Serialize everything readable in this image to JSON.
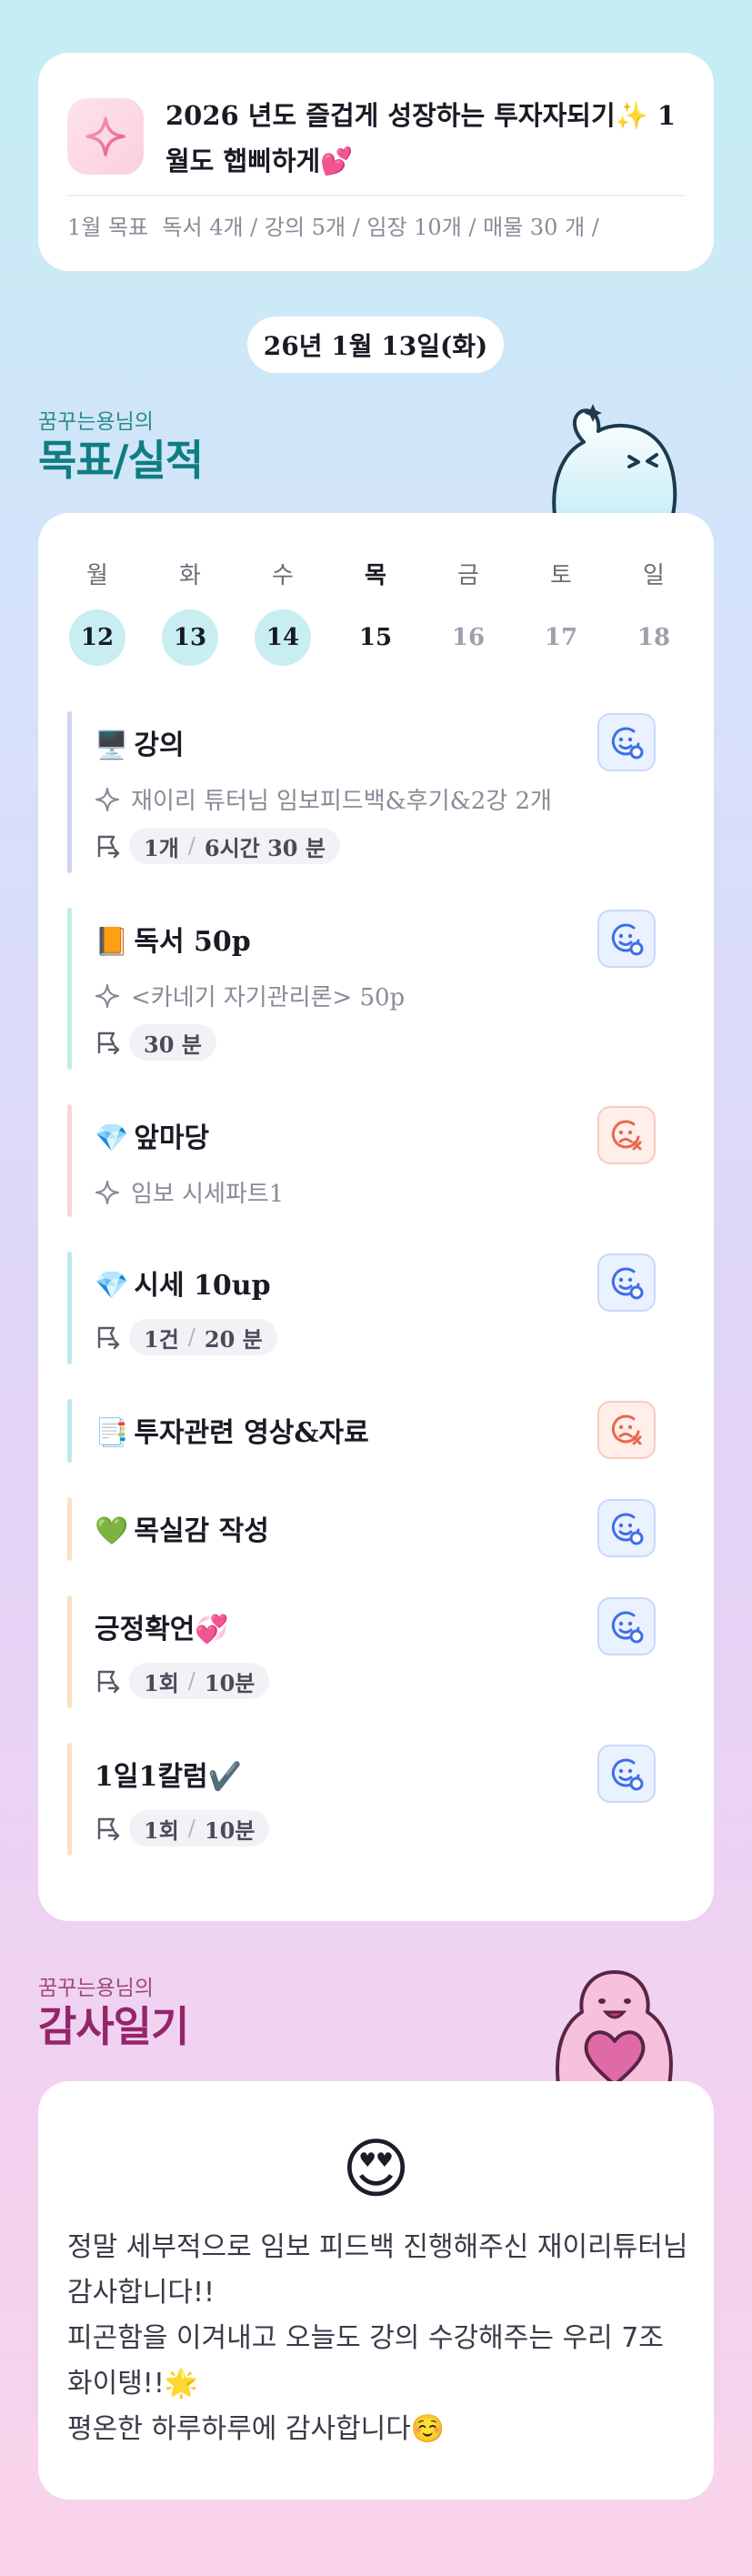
{
  "goal": {
    "title": "2026 년도 즐겁게 성장하는 투자자되기✨ 1월도 햅삐하게💕",
    "monthly_label": "1월 목표",
    "monthly_items": "독서 4개 / 강의 5개 / 임장 10개 / 매물 30 개 /"
  },
  "date_pill": "26년 1월 13일(화)",
  "section_goals": {
    "subtitle": "꿈꾸는용님의",
    "title": "목표/실적"
  },
  "week": {
    "days": [
      {
        "name": "월",
        "date": "12"
      },
      {
        "name": "화",
        "date": "13"
      },
      {
        "name": "수",
        "date": "14"
      },
      {
        "name": "목",
        "date": "15"
      },
      {
        "name": "금",
        "date": "16"
      },
      {
        "name": "토",
        "date": "17"
      },
      {
        "name": "일",
        "date": "18"
      }
    ]
  },
  "tasks": [
    {
      "emoji": "🖥️",
      "title": "강의",
      "detail": "재이리 튜터님 임보피드백&후기&2강 2개",
      "count": "1개",
      "time": "6시간 30 분",
      "status": "done",
      "bar_color": "#cfd4ee"
    },
    {
      "emoji": "📙",
      "title": "독서 50p",
      "detail": "<카네기 자기관리론> 50p",
      "count": "",
      "time": "30 분",
      "status": "done",
      "bar_color": "#bfeee1"
    },
    {
      "emoji": "💎",
      "title": "앞마당",
      "detail": "임보 시세파트1",
      "count": "",
      "time": "",
      "status": "missed",
      "bar_color": "#f9d6d6"
    },
    {
      "emoji": "💎",
      "title": "시세 10up",
      "detail": "",
      "count": "1건",
      "time": "20 분",
      "status": "done",
      "bar_color": "#bfe8f0"
    },
    {
      "emoji": "📑",
      "title": "투자관련 영상&자료",
      "detail": "",
      "count": "",
      "time": "",
      "status": "missed",
      "bar_color": "#bfe8f0"
    },
    {
      "emoji": "💚",
      "title": "목실감 작성",
      "detail": "",
      "count": "",
      "time": "",
      "status": "done",
      "bar_color": "#f8e2c2"
    },
    {
      "emoji": "",
      "title": "긍정확언💞",
      "detail": "",
      "count": "1회",
      "time": "10분",
      "status": "done",
      "bar_color": "#f8e2c2"
    },
    {
      "emoji": "",
      "title": "1일1칼럼✔️",
      "detail": "",
      "count": "1회",
      "time": "10분",
      "status": "done",
      "bar_color": "#f8e2c2"
    }
  ],
  "section_diary": {
    "subtitle": "꿈꾸는용님의",
    "title": "감사일기"
  },
  "diary": {
    "emoji": "😍",
    "text": "정말 세부적으로 임보 피드백 진행해주신 재이리튜터님 감사합니다!!\n피곤함을 이겨내고 오늘도 강의 수강해주는 우리 7조 화이탱!!🌟\n평온한 하루하루에 감사합니다☺️"
  },
  "colors": {
    "accent_teal": "#0e7d82",
    "accent_plum": "#93256a",
    "done_face": "#3d6fe6",
    "missed_face": "#e8684f",
    "completed_day_bg": "#c8eef2"
  },
  "icons": {
    "goal_icon": "sparkle-icon",
    "task_detail_icon": "sparkle-outline-icon",
    "task_time_icon": "flag-icon",
    "status_done_icon": "smile-face-icon",
    "status_missed_icon": "frown-face-icon"
  }
}
